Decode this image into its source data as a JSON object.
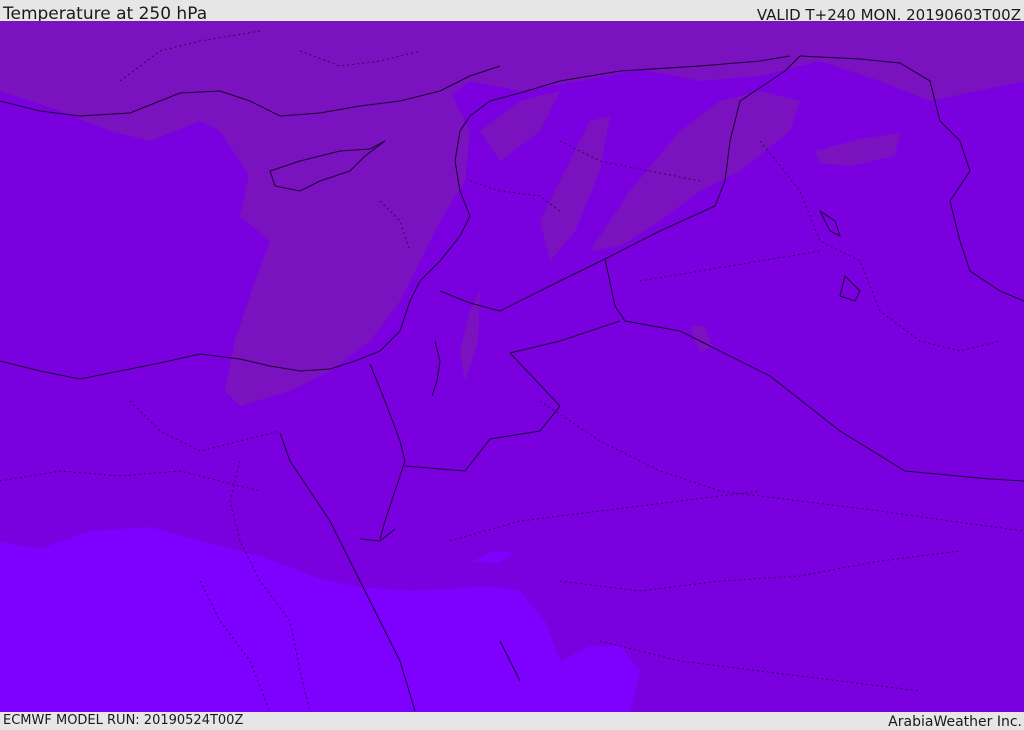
{
  "header": {
    "title": "Temperature at 250 hPa",
    "valid": "VALID T+240 MON. 20190603T00Z"
  },
  "footer": {
    "model_run": "ECMWF MODEL RUN: 20190524T00Z",
    "credit": "ArabiaWeather Inc."
  },
  "map": {
    "colors": {
      "base": "#7a00e0",
      "warm_band": "#7c14b8",
      "cold_south": "#7e00ff",
      "mid_south": "#7800e8",
      "border_line": "#1a0030"
    }
  }
}
